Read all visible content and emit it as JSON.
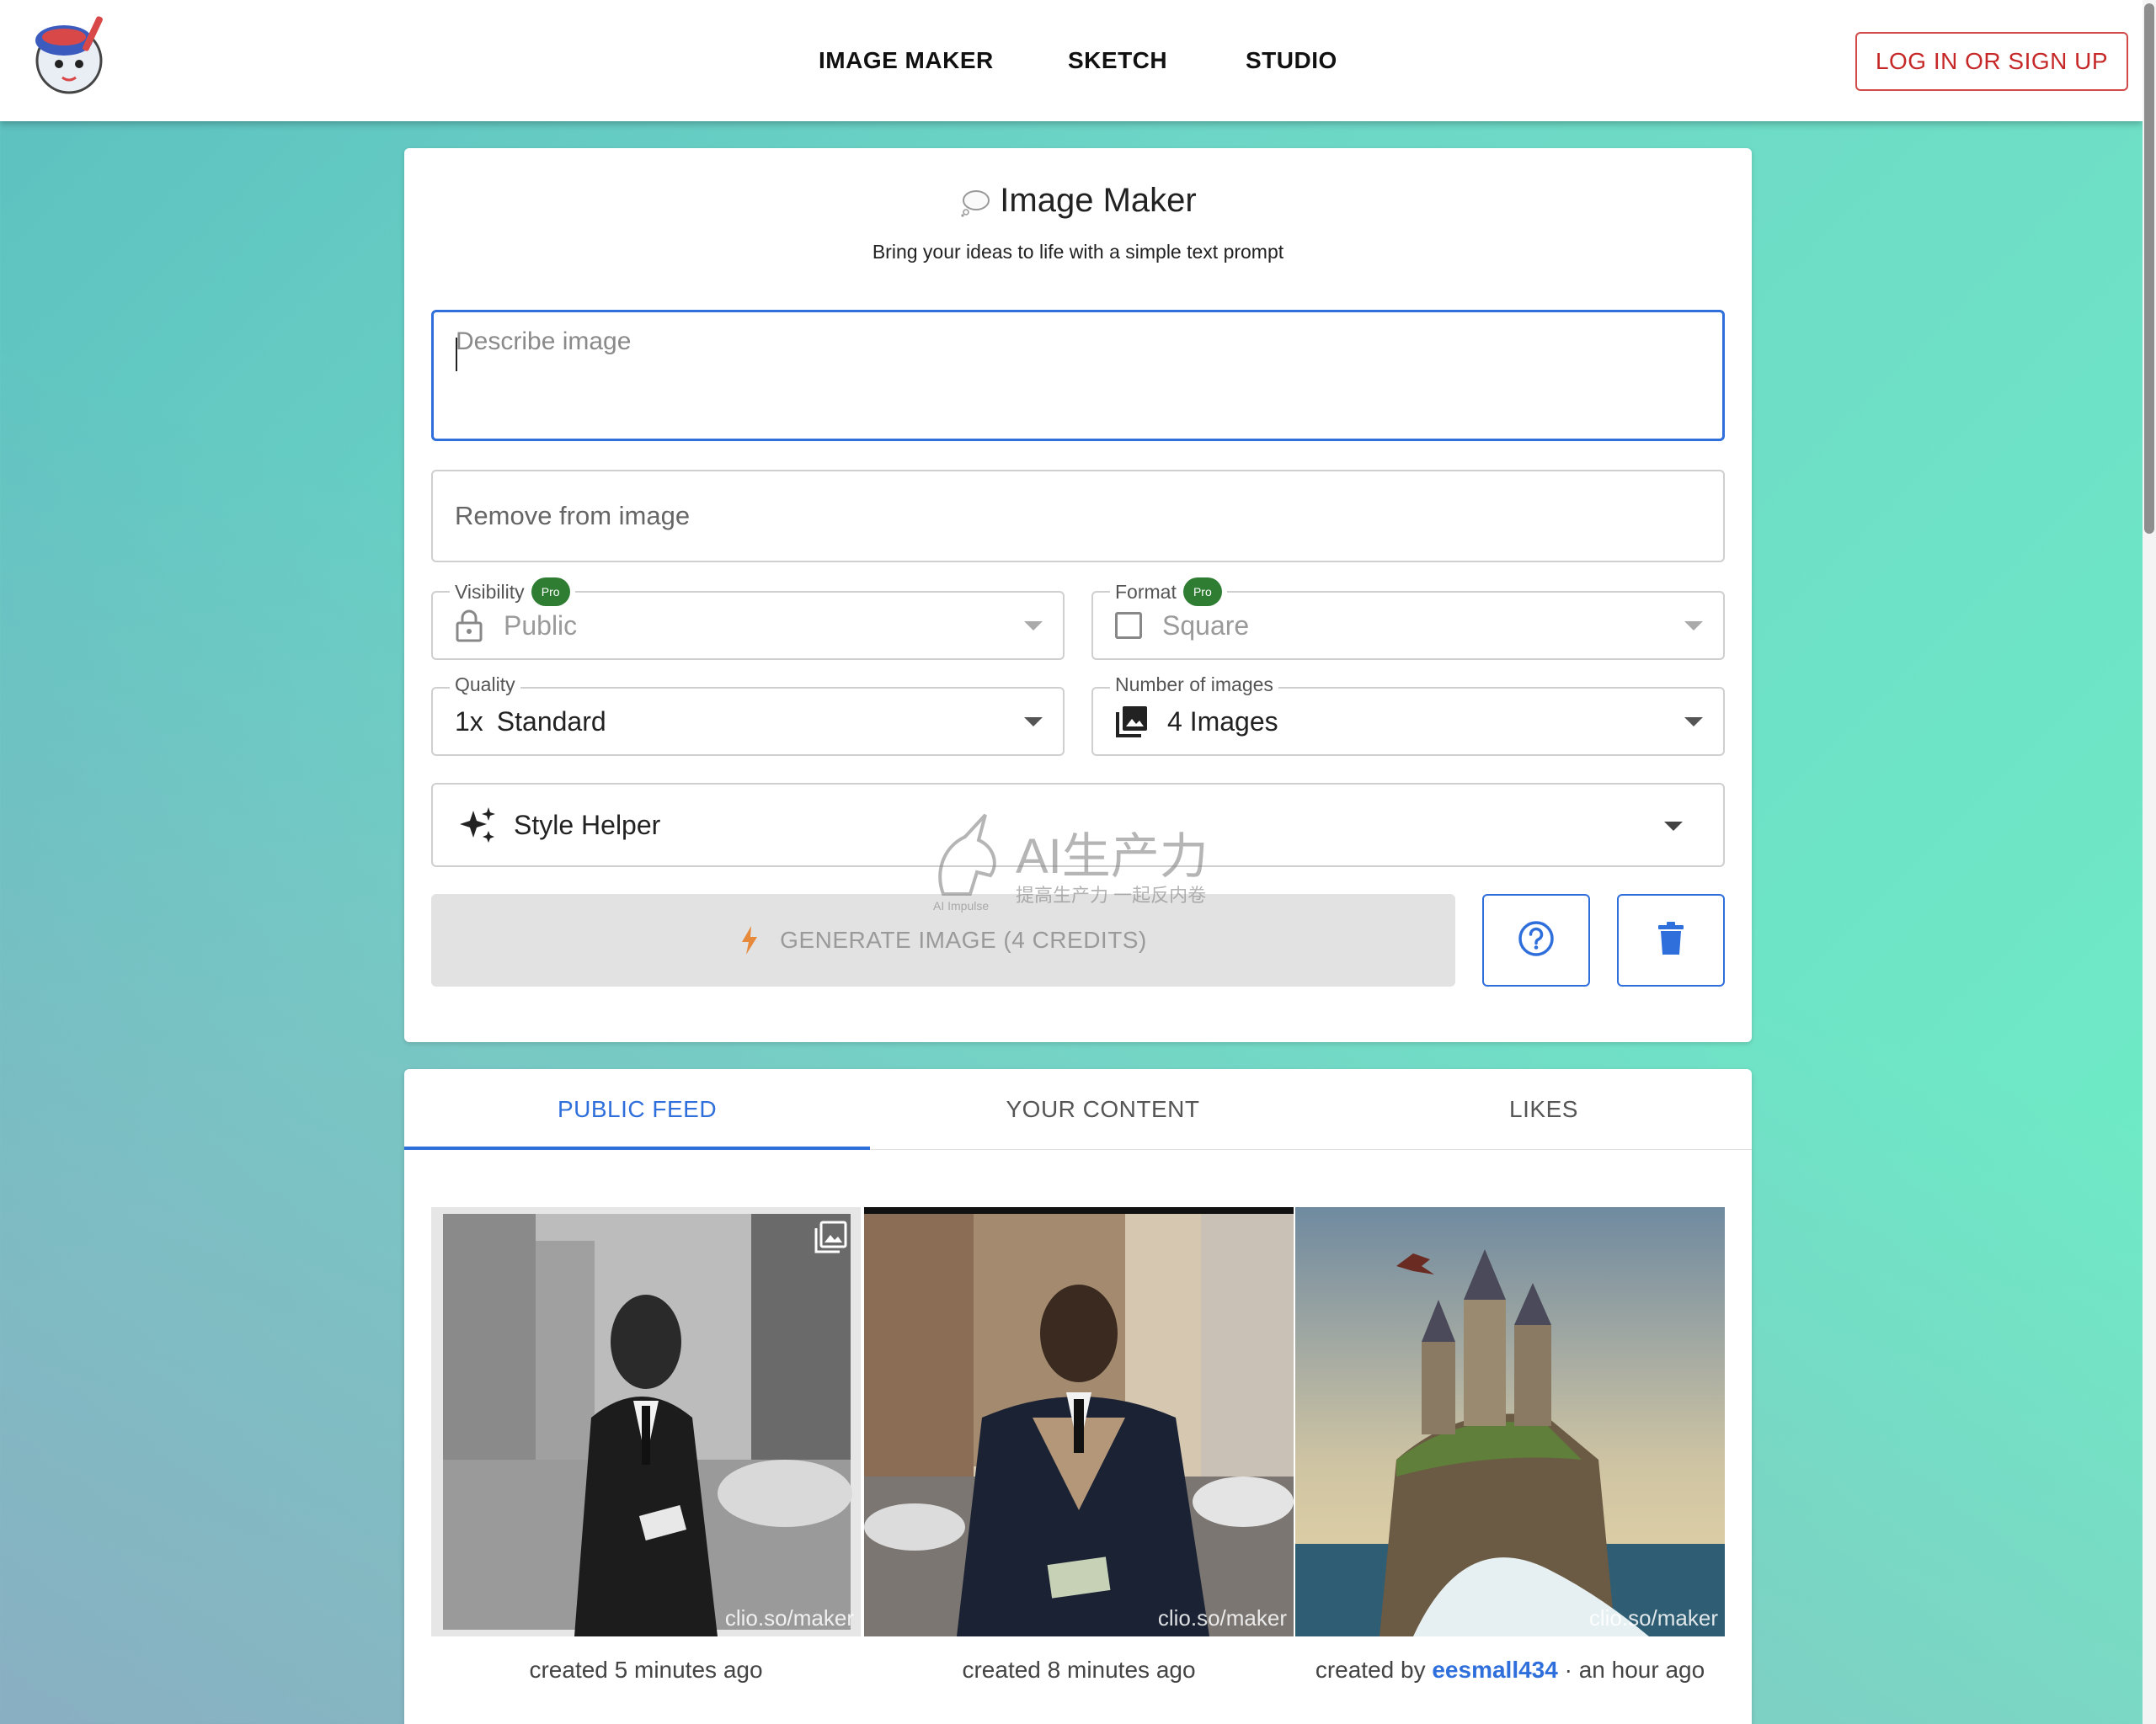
{
  "header": {
    "nav": [
      "IMAGE MAKER",
      "SKETCH",
      "STUDIO"
    ],
    "login_label": "LOG IN OR SIGN UP"
  },
  "maker": {
    "title": "Image Maker",
    "subtitle": "Bring your ideas to life with a simple text prompt",
    "describe_placeholder": "Describe image",
    "remove_placeholder": "Remove from image",
    "visibility": {
      "label": "Visibility",
      "badge": "Pro",
      "value": "Public"
    },
    "format": {
      "label": "Format",
      "badge": "Pro",
      "value": "Square"
    },
    "quality": {
      "label": "Quality",
      "prefix": "1x",
      "value": "Standard"
    },
    "num_images": {
      "label": "Number of images",
      "value": "4 Images"
    },
    "style_helper": "Style Helper",
    "generate_label": "GENERATE IMAGE (4 CREDITS)"
  },
  "watermark": {
    "big": "AI生产力",
    "small": "提高生产力 一起反内卷",
    "tiny": "AI Impulse"
  },
  "feed": {
    "tabs": [
      "PUBLIC FEED",
      "YOUR CONTENT",
      "LIKES"
    ],
    "items": [
      {
        "watermark": "clio.so/maker",
        "caption": "created 5 minutes ago"
      },
      {
        "watermark": "clio.so/maker",
        "caption": "created 8 minutes ago"
      },
      {
        "watermark": "clio.so/maker",
        "caption_prefix": "created by ",
        "user": "eesmall434",
        "caption_suffix": " · an hour ago"
      }
    ]
  },
  "colors": {
    "accent": "#2f6fdc",
    "danger": "#c62828",
    "pro_badge": "#2e7d32"
  }
}
